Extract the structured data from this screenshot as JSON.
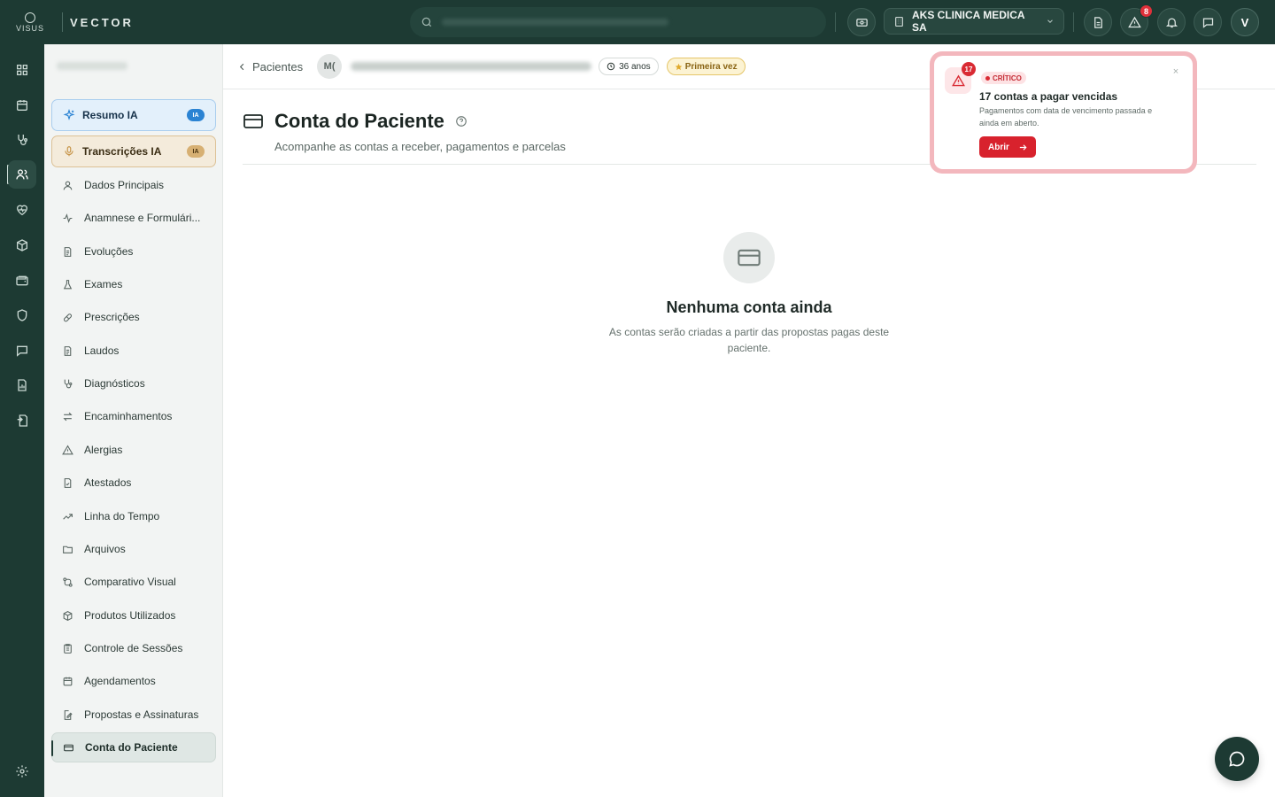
{
  "app": {
    "logo_small": "VISUS",
    "name": "VECTOR"
  },
  "topbar": {
    "clinic_name": "AKS CLINICA MEDICA SA",
    "alerts_badge": "8",
    "avatar_initial": "V"
  },
  "sidebar": {
    "ai_items": [
      {
        "label": "Resumo IA",
        "badge": "IA"
      },
      {
        "label": "Transcrições IA",
        "badge": "IA"
      }
    ],
    "items": [
      {
        "label": "Dados Principais"
      },
      {
        "label": "Anamnese e Formulári..."
      },
      {
        "label": "Evoluções"
      },
      {
        "label": "Exames"
      },
      {
        "label": "Prescrições"
      },
      {
        "label": "Laudos"
      },
      {
        "label": "Diagnósticos"
      },
      {
        "label": "Encaminhamentos"
      },
      {
        "label": "Alergias"
      },
      {
        "label": "Atestados"
      },
      {
        "label": "Linha do Tempo"
      },
      {
        "label": "Arquivos"
      },
      {
        "label": "Comparativo Visual"
      },
      {
        "label": "Produtos Utilizados"
      },
      {
        "label": "Controle de Sessões"
      },
      {
        "label": "Agendamentos"
      },
      {
        "label": "Propostas e Assinaturas"
      },
      {
        "label": "Conta do Paciente"
      }
    ]
  },
  "header": {
    "breadcrumb": "Pacientes",
    "patient_initials": "M(",
    "age": "36 anos",
    "visit_tag": "Primeira vez"
  },
  "page": {
    "title": "Conta do Paciente",
    "subtitle": "Acompanhe as contas a receber, pagamentos e parcelas"
  },
  "empty_state": {
    "title": "Nenhuma conta ainda",
    "description": "As contas serão criadas a partir das propostas pagas deste paciente."
  },
  "alert": {
    "count": "17",
    "level": "CRÍTICO",
    "title": "17 contas a pagar vencidas",
    "description": "Pagamentos com data de vencimento passada e ainda em aberto.",
    "button": "Abrir",
    "close": "×"
  },
  "colors": {
    "topbar": "#1d3a33",
    "accent_red": "#d8222d",
    "ai_blue": "#2b83d3",
    "ai_gold": "#d7b073"
  }
}
